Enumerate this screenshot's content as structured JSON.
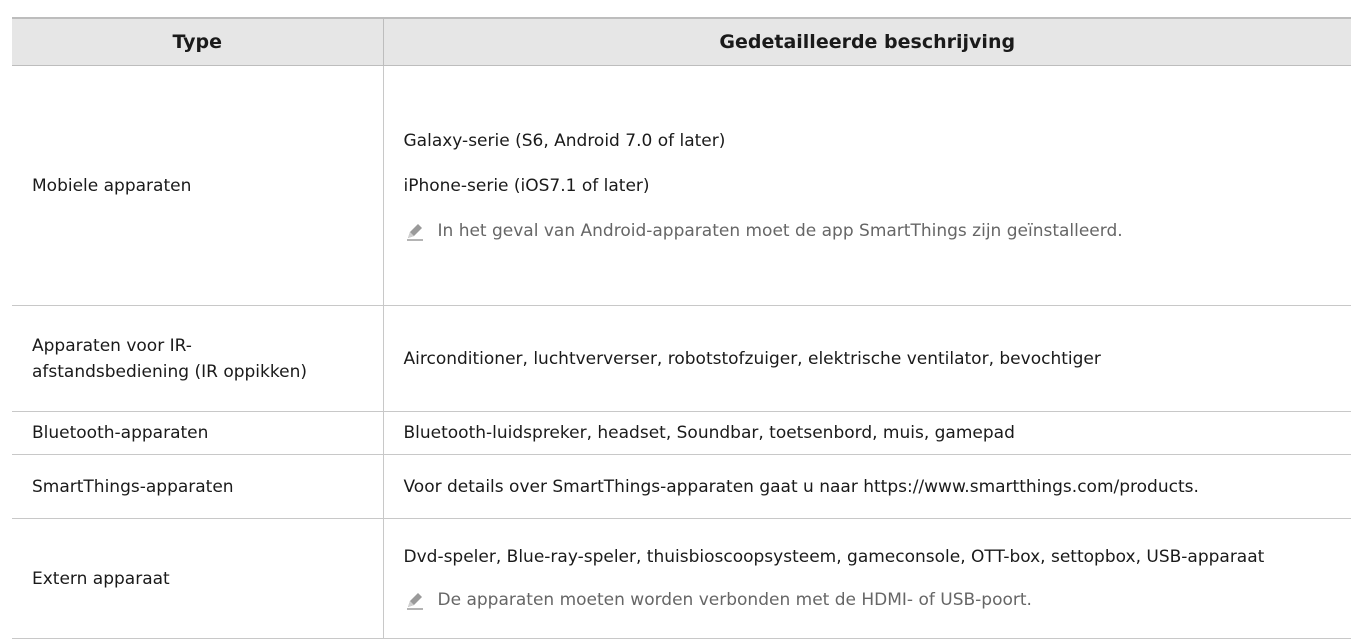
{
  "table": {
    "headers": [
      "Type",
      "Gedetailleerde beschrijving"
    ],
    "rows": [
      {
        "type": "Mobiele apparaten",
        "lines": [
          "Galaxy-serie (S6, Android 7.0 of later)",
          "iPhone-serie (iOS7.1 of later)"
        ],
        "note": "In het geval van Android-apparaten moet de app SmartThings zijn geïnstalleerd."
      },
      {
        "type": "Apparaten voor IR-afstandsbediening (IR oppikken)",
        "lines": [
          "Airconditioner, luchtververser, robotstofzuiger, elektrische ventilator, bevochtiger"
        ]
      },
      {
        "type": "Bluetooth-apparaten",
        "lines": [
          "Bluetooth-luidspreker, headset, Soundbar, toetsenbord, muis, gamepad"
        ]
      },
      {
        "type": "SmartThings-apparaten",
        "lines": [
          "Voor details over SmartThings-apparaten gaat u naar https://www.smartthings.com/products."
        ]
      },
      {
        "type": "Extern apparaat",
        "lines": [
          "Dvd-speler, Blue-ray-speler, thuisbioscoopsysteem, gameconsole, OTT-box, settopbox, USB-apparaat"
        ],
        "note": "De apparaten moeten worden verbonden met de HDMI- of USB-poort."
      }
    ]
  },
  "icons": {
    "note": "pencil-note-icon"
  },
  "colors": {
    "header_bg": "#e6e6e6",
    "note_text": "#666666",
    "border": "#c8c8c8"
  }
}
